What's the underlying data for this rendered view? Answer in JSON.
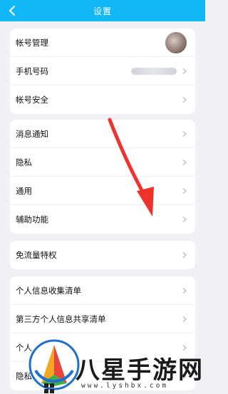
{
  "header": {
    "title": "设置"
  },
  "groups": [
    {
      "items": [
        {
          "label": "帐号管理",
          "right": "avatar"
        },
        {
          "label": "手机号码",
          "right": "masked"
        },
        {
          "label": "帐号安全",
          "right": "chevron"
        }
      ]
    },
    {
      "items": [
        {
          "label": "消息通知",
          "right": "chevron"
        },
        {
          "label": "隐私",
          "right": "chevron"
        },
        {
          "label": "通用",
          "right": "chevron"
        },
        {
          "label": "辅助功能",
          "right": "chevron"
        }
      ]
    },
    {
      "items": [
        {
          "label": "免流量特权",
          "right": "chevron"
        }
      ]
    },
    {
      "items": [
        {
          "label": "个人信息收集清单",
          "right": "chevron"
        },
        {
          "label": "第三方个人信息共享清单",
          "right": "chevron"
        },
        {
          "label": "个人",
          "right": "chevron"
        },
        {
          "label": "隐私",
          "right": "chevron"
        }
      ]
    }
  ],
  "watermark": {
    "title": "八星手游网",
    "url": "www.lyshbx.com"
  },
  "colors": {
    "header_bg": "#12b7f5",
    "page_bg": "#f0f1f5",
    "annotation_arrow": "#f0322d"
  }
}
